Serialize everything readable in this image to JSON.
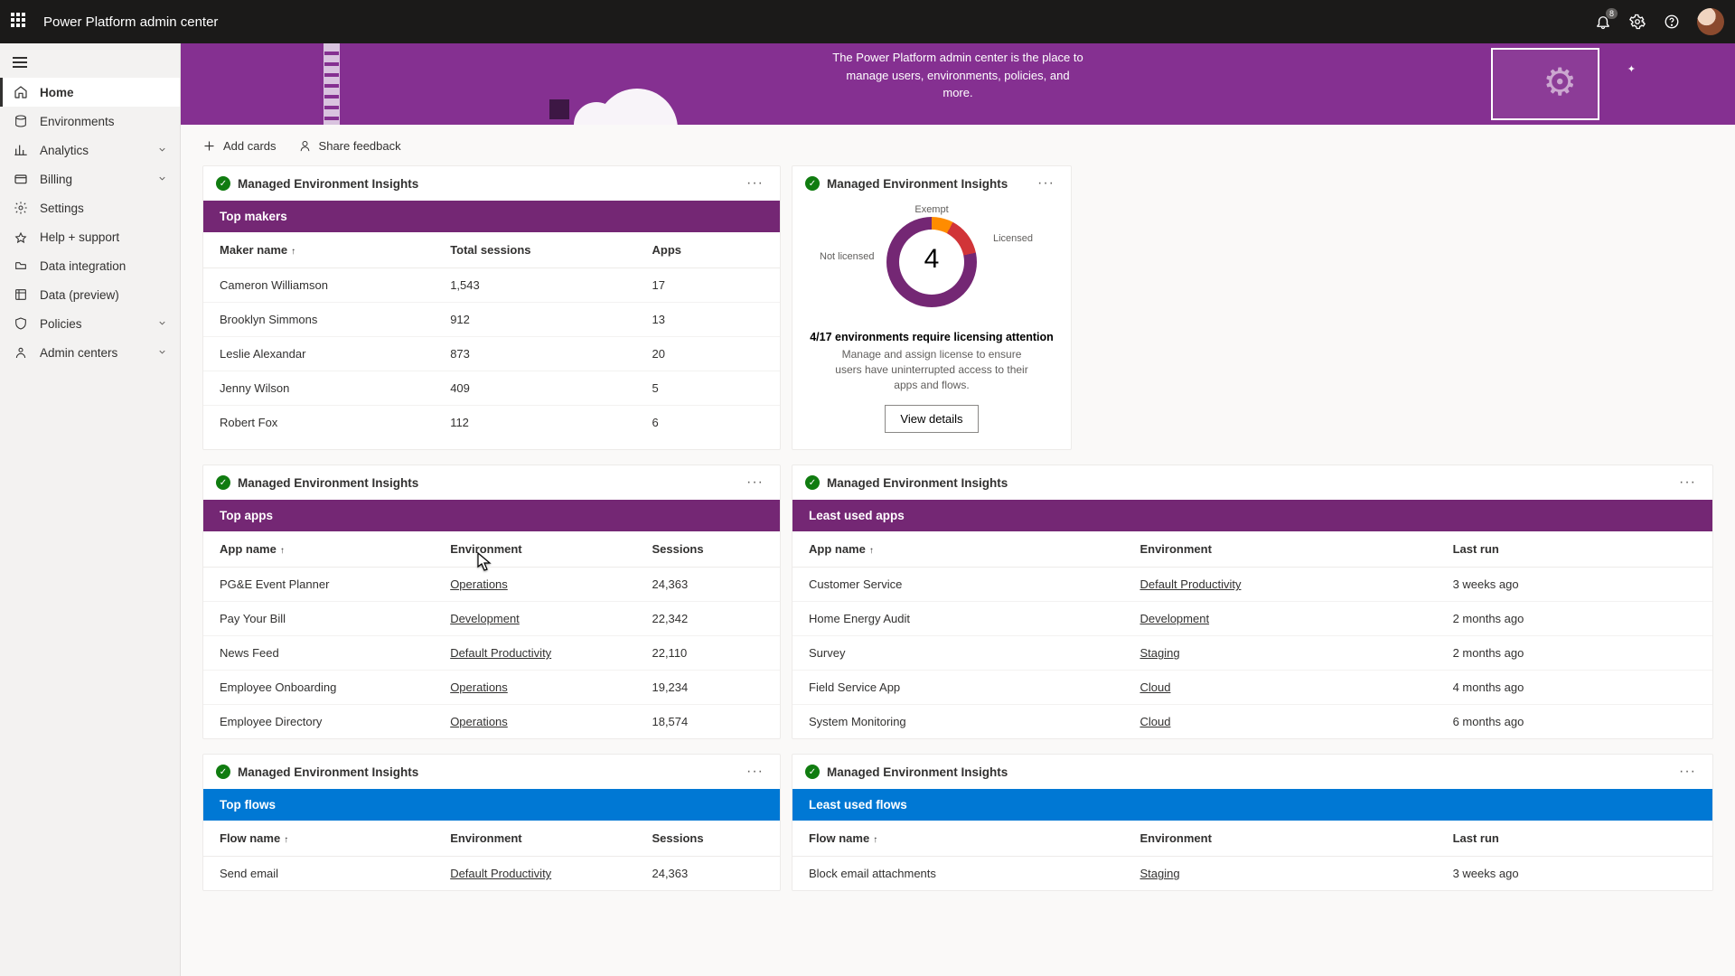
{
  "header": {
    "title": "Power Platform admin center",
    "badge": "8"
  },
  "hero": {
    "line1": "The Power Platform admin center is the place to",
    "line2": "manage users, environments, policies, and more."
  },
  "toolbar": {
    "add": "Add cards",
    "feedback": "Share feedback"
  },
  "nav": {
    "home": "Home",
    "envs": "Environments",
    "analytics": "Analytics",
    "billing": "Billing",
    "settings": "Settings",
    "help": "Help + support",
    "dataint": "Data integration",
    "dataprev": "Data (preview)",
    "policies": "Policies",
    "admin": "Admin centers"
  },
  "cardTitle": "Managed Environment Insights",
  "topMakers": {
    "band": "Top makers",
    "cols": {
      "name": "Maker name",
      "sessions": "Total sessions",
      "apps": "Apps"
    },
    "rows": [
      {
        "name": "Cameron Williamson",
        "sessions": "1,543",
        "apps": "17"
      },
      {
        "name": "Brooklyn Simmons",
        "sessions": "912",
        "apps": "13"
      },
      {
        "name": "Leslie Alexandar",
        "sessions": "873",
        "apps": "20"
      },
      {
        "name": "Jenny Wilson",
        "sessions": "409",
        "apps": "5"
      },
      {
        "name": "Robert Fox",
        "sessions": "112",
        "apps": "6"
      }
    ]
  },
  "licensing": {
    "labels": {
      "exempt": "Exempt",
      "notLicensed": "Not licensed",
      "licensed": "Licensed"
    },
    "center": "4",
    "bold": "4/17 environments require licensing attention",
    "sub": "Manage and assign license to ensure users have uninterrupted access to their apps and flows.",
    "btn": "View details"
  },
  "topApps": {
    "band": "Top apps",
    "cols": {
      "name": "App name",
      "env": "Environment",
      "sessions": "Sessions"
    },
    "rows": [
      {
        "name": "PG&E Event Planner",
        "env": "Operations",
        "sessions": "24,363"
      },
      {
        "name": "Pay Your Bill",
        "env": "Development",
        "sessions": "22,342"
      },
      {
        "name": "News Feed",
        "env": "Default Productivity",
        "sessions": "22,110"
      },
      {
        "name": "Employee Onboarding",
        "env": "Operations",
        "sessions": "19,234"
      },
      {
        "name": "Employee Directory",
        "env": "Operations",
        "sessions": "18,574"
      }
    ]
  },
  "leastApps": {
    "band": "Least used apps",
    "cols": {
      "name": "App name",
      "env": "Environment",
      "last": "Last run"
    },
    "rows": [
      {
        "name": "Customer Service",
        "env": "Default Productivity",
        "last": "3 weeks ago"
      },
      {
        "name": "Home Energy Audit",
        "env": "Development",
        "last": "2 months ago"
      },
      {
        "name": "Survey",
        "env": "Staging",
        "last": "2 months ago"
      },
      {
        "name": "Field Service App",
        "env": "Cloud",
        "last": "4 months ago"
      },
      {
        "name": "System Monitoring",
        "env": "Cloud",
        "last": "6 months ago"
      }
    ]
  },
  "topFlows": {
    "band": "Top flows",
    "cols": {
      "name": "Flow name",
      "env": "Environment",
      "sessions": "Sessions"
    },
    "rows": [
      {
        "name": "Send email",
        "env": "Default Productivity",
        "sessions": "24,363"
      }
    ]
  },
  "leastFlows": {
    "band": "Least used flows",
    "cols": {
      "name": "Flow name",
      "env": "Environment",
      "last": "Last run"
    },
    "rows": [
      {
        "name": "Block email attachments",
        "env": "Staging",
        "last": "3 weeks ago"
      }
    ]
  }
}
